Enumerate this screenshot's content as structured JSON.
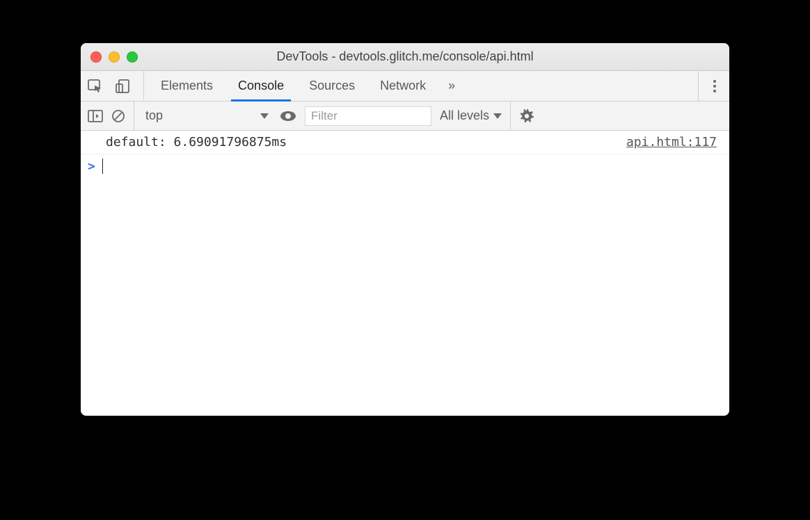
{
  "window": {
    "title": "DevTools - devtools.glitch.me/console/api.html"
  },
  "tabs": {
    "items": [
      "Elements",
      "Console",
      "Sources",
      "Network"
    ],
    "active_index": 1,
    "overflow_glyph": "»"
  },
  "console_toolbar": {
    "context": "top",
    "filter_placeholder": "Filter",
    "filter_value": "",
    "levels_label": "All levels"
  },
  "console": {
    "logs": [
      {
        "message": "default: 6.69091796875ms",
        "source": "api.html:117"
      }
    ],
    "prompt_glyph": ">",
    "prompt_value": ""
  }
}
